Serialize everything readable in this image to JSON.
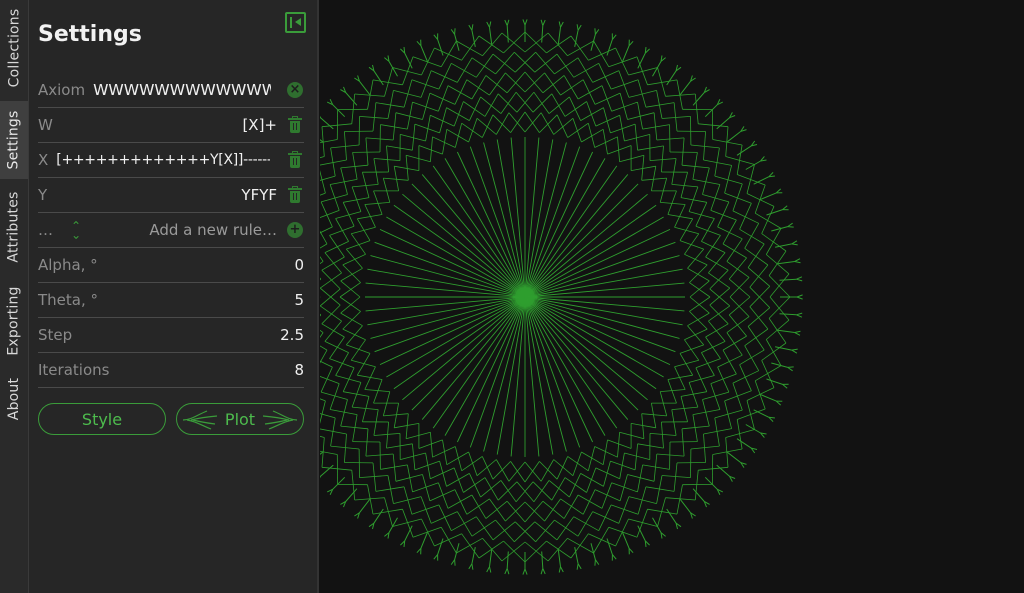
{
  "tabs": [
    {
      "label": "Collections",
      "active": false
    },
    {
      "label": "Settings",
      "active": true
    },
    {
      "label": "Attributes",
      "active": false
    },
    {
      "label": "Exporting",
      "active": false
    },
    {
      "label": "About",
      "active": false
    }
  ],
  "panel": {
    "title": "Settings",
    "collapse_icon": "sidebar-collapse-icon"
  },
  "axiom": {
    "label": "Axiom",
    "value": "WWWWWWWWWWWWW"
  },
  "rules": [
    {
      "symbol": "W",
      "value": "[X]+"
    },
    {
      "symbol": "X",
      "value": "[+++++++++++++Y[X]]-------------"
    },
    {
      "symbol": "Y",
      "value": "YFYF"
    }
  ],
  "new_rule": {
    "symbol": "…",
    "placeholder": "Add a new rule…"
  },
  "params": [
    {
      "label": "Alpha, °",
      "value": "0"
    },
    {
      "label": "Theta, °",
      "value": "5"
    },
    {
      "label": "Step",
      "value": "2.5"
    },
    {
      "label": "Iterations",
      "value": "8"
    }
  ],
  "buttons": {
    "style": "Style",
    "plot": "Plot"
  },
  "colors": {
    "accent": "#3a9c3a",
    "plot_line": "#2f9e2f",
    "background": "#121212",
    "panel": "#262626"
  }
}
